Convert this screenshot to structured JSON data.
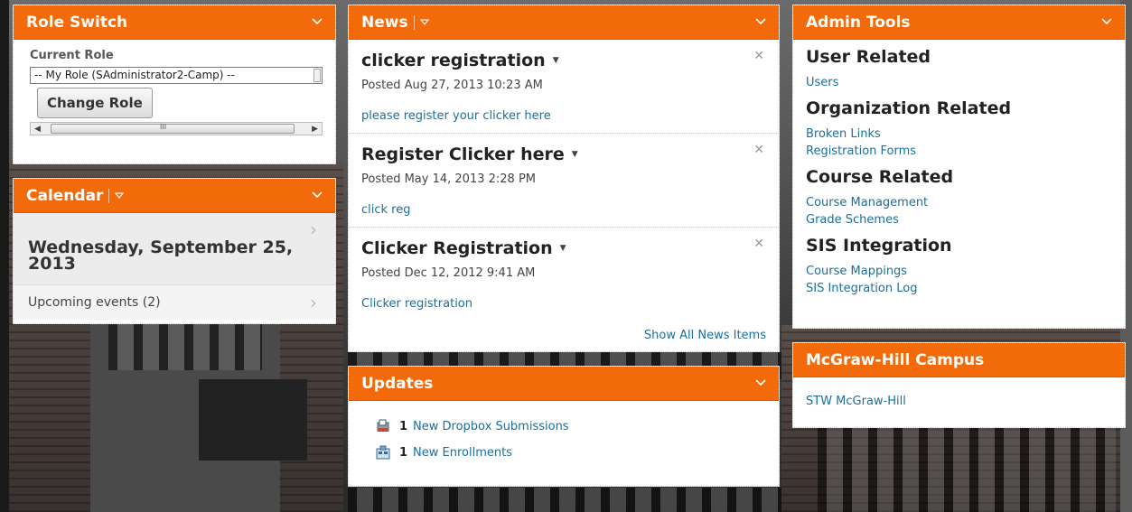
{
  "widgets": {
    "role_switch": {
      "title": "Role Switch",
      "current_role_label": "Current Role",
      "selected_role": "-- My Role (SAdministrator2-Camp) --",
      "change_role_button": "Change Role",
      "scrollbar_grip": "III"
    },
    "calendar": {
      "title": "Calendar",
      "date": "Wednesday, September 25, 2013",
      "upcoming": "Upcoming events (2)"
    },
    "news": {
      "title": "News",
      "items": [
        {
          "title": "clicker registration",
          "posted": "Posted Aug 27, 2013 10:23 AM",
          "body": "please register your clicker here"
        },
        {
          "title": "Register Clicker here",
          "posted": "Posted May 14, 2013 2:28 PM",
          "body": "click reg"
        },
        {
          "title": "Clicker Registration",
          "posted": "Posted Dec 12, 2012 9:41 AM",
          "body": "Clicker registration"
        }
      ],
      "show_all": "Show All News Items"
    },
    "updates": {
      "title": "Updates",
      "items": [
        {
          "count": "1",
          "label": "New Dropbox Submissions",
          "icon": "dropbox-icon"
        },
        {
          "count": "1",
          "label": "New Enrollments",
          "icon": "enrollments-icon"
        }
      ]
    },
    "admin_tools": {
      "title": "Admin Tools",
      "sections": [
        {
          "heading": "User Related",
          "links": [
            "Users"
          ]
        },
        {
          "heading": "Organization Related",
          "links": [
            "Broken Links",
            "Registration Forms"
          ]
        },
        {
          "heading": "Course Related",
          "links": [
            "Course Management",
            "Grade Schemes"
          ]
        },
        {
          "heading": "SIS Integration",
          "links": [
            "Course Mappings",
            "SIS Integration Log"
          ]
        }
      ]
    },
    "campus": {
      "title": "McGraw-Hill Campus",
      "link": "STW McGraw-Hill"
    }
  },
  "colors": {
    "header_orange": "#f26a0a",
    "link_blue": "#1a6f9c"
  }
}
